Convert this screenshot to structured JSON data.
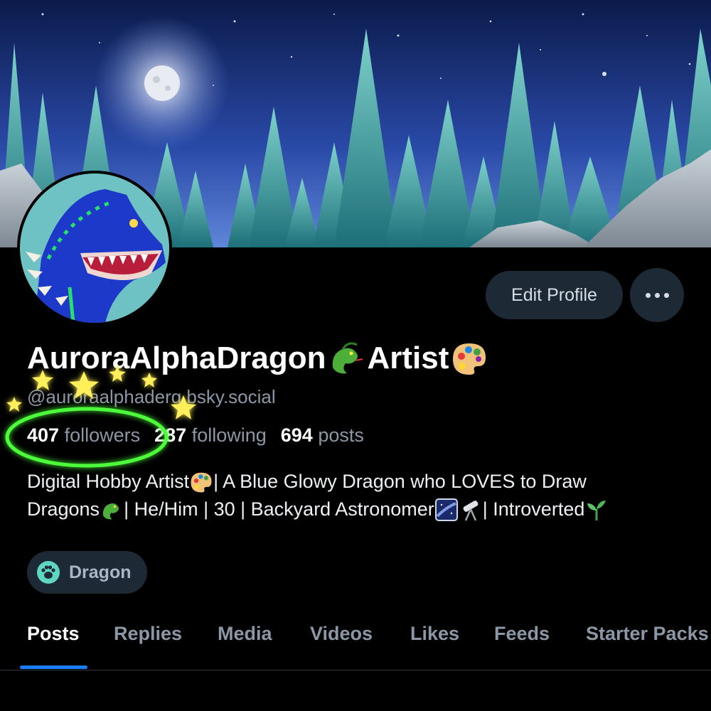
{
  "profile": {
    "display_name": "AuroraAlphaDragon",
    "display_name_suffix": "Artist",
    "handle": "@auroraalphaderg.bsky.social"
  },
  "stats": {
    "followers_count": "407",
    "followers_label": "followers",
    "following_count": "287",
    "following_label": "following",
    "posts_count": "694",
    "posts_label": "posts"
  },
  "bio": {
    "line1_a": "Digital Hobby Artist",
    "line1_b": "| A Blue Glowy Dragon who LOVES to Draw",
    "line2_a": "Dragons",
    "line2_b": "| He/Him | 30 | Backyard Astronomer",
    "line2_c": "| Introverted"
  },
  "tag": {
    "label": "Dragon",
    "icon": "paw-icon"
  },
  "actions": {
    "edit_profile": "Edit Profile",
    "more_icon": "ellipsis-icon"
  },
  "tabs": [
    "Posts",
    "Replies",
    "Media",
    "Videos",
    "Likes",
    "Feeds",
    "Starter Packs"
  ],
  "active_tab": "Posts",
  "colors": {
    "accent": "#1a7df5",
    "button_bg": "#1e2936",
    "muted_text": "#8c97a6",
    "highlight_circle": "#4dff3a"
  }
}
